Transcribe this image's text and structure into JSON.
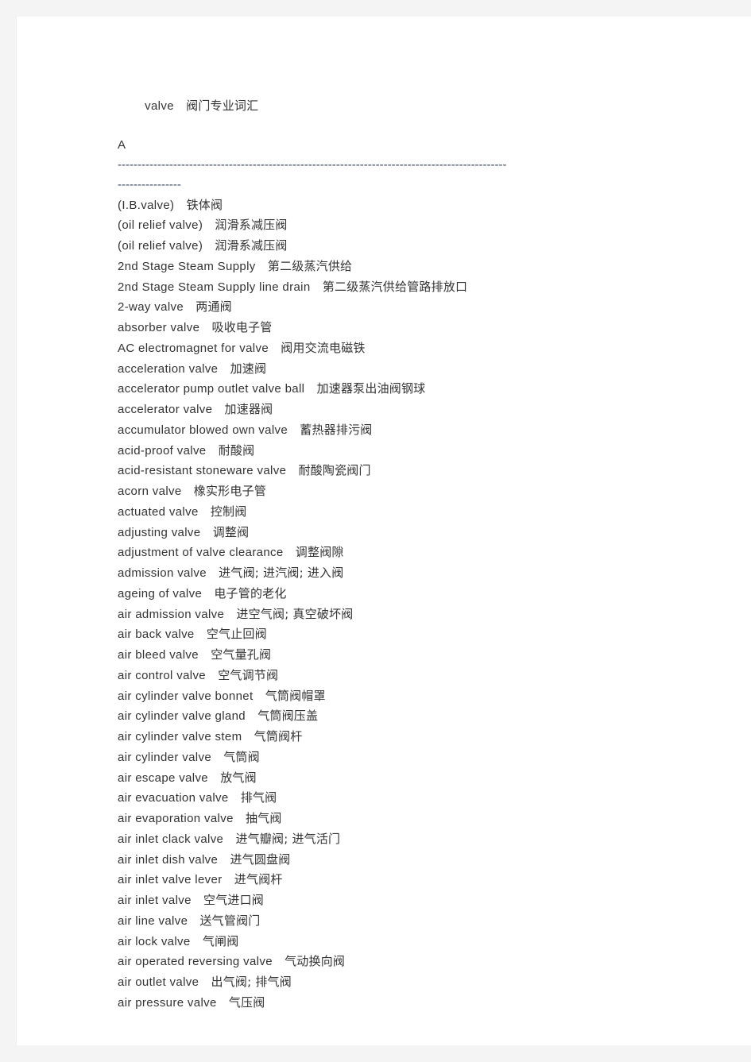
{
  "document": {
    "title_line": {
      "term": "valve",
      "translation": "阀门专业词汇"
    },
    "section_letter": "A",
    "rules": {
      "long": "--------------------------------------------------------------------------------------------------",
      "short": "----------------"
    },
    "entries": [
      {
        "term": "(I.B.valve)",
        "translation": "铁体阀"
      },
      {
        "term": "(oil relief valve)",
        "translation": "润滑系减压阀"
      },
      {
        "term": "(oil relief valve)",
        "translation": "润滑系减压阀"
      },
      {
        "term": "2nd Stage Steam Supply",
        "translation": "第二级蒸汽供给"
      },
      {
        "term": "2nd Stage Steam Supply line drain",
        "translation": "第二级蒸汽供给管路排放口"
      },
      {
        "term": "2-way valve",
        "translation": "两通阀"
      },
      {
        "term": "absorber valve",
        "translation": "吸收电子管"
      },
      {
        "term": "AC electromagnet for valve",
        "translation": "阀用交流电磁铁"
      },
      {
        "term": "acceleration valve",
        "translation": "加速阀"
      },
      {
        "term": "accelerator pump outlet valve ball",
        "translation": "加速器泵出油阀钢球"
      },
      {
        "term": "accelerator valve",
        "translation": "加速器阀"
      },
      {
        "term": "accumulator blowed own valve",
        "translation": "蓄热器排污阀"
      },
      {
        "term": "acid-proof valve",
        "translation": "耐酸阀"
      },
      {
        "term": "acid-resistant stoneware valve",
        "translation": "耐酸陶瓷阀门"
      },
      {
        "term": "acorn valve",
        "translation": "橡实形电子管"
      },
      {
        "term": "actuated valve",
        "translation": "控制阀"
      },
      {
        "term": "adjusting valve",
        "translation": "调整阀"
      },
      {
        "term": "adjustment of valve clearance",
        "translation": "调整阀隙"
      },
      {
        "term": "admission valve",
        "translation": "进气阀; 进汽阀; 进入阀"
      },
      {
        "term": "ageing of valve",
        "translation": "电子管的老化"
      },
      {
        "term": "air admission valve",
        "translation": "进空气阀; 真空破坏阀"
      },
      {
        "term": "air back valve",
        "translation": "空气止回阀"
      },
      {
        "term": "air bleed valve",
        "translation": "空气量孔阀"
      },
      {
        "term": "air control valve",
        "translation": "空气调节阀"
      },
      {
        "term": "air cylinder valve bonnet",
        "translation": "气筒阀帽罩"
      },
      {
        "term": "air cylinder valve gland",
        "translation": "气筒阀压盖"
      },
      {
        "term": "air cylinder valve stem",
        "translation": "气筒阀杆"
      },
      {
        "term": "air cylinder valve",
        "translation": "气筒阀"
      },
      {
        "term": "air escape valve",
        "translation": "放气阀"
      },
      {
        "term": "air evacuation valve",
        "translation": "排气阀"
      },
      {
        "term": "air evaporation valve",
        "translation": "抽气阀"
      },
      {
        "term": "air inlet clack valve",
        "translation": "进气瓣阀; 进气活门"
      },
      {
        "term": "air inlet dish valve",
        "translation": "进气圆盘阀"
      },
      {
        "term": "air inlet valve lever",
        "translation": "进气阀杆"
      },
      {
        "term": "air inlet valve",
        "translation": "空气进口阀"
      },
      {
        "term": "air line valve",
        "translation": "送气管阀门"
      },
      {
        "term": "air lock valve",
        "translation": "气闸阀"
      },
      {
        "term": "air operated reversing valve",
        "translation": "气动换向阀"
      },
      {
        "term": "air outlet valve",
        "translation": "出气阀; 排气阀"
      },
      {
        "term": "air pressure valve",
        "translation": "气压阀"
      }
    ]
  },
  "colors": {
    "page_background": "#ffffff",
    "canvas_background": "#f4f4f4",
    "text": "#333333",
    "rule": "#3d4a5c"
  }
}
